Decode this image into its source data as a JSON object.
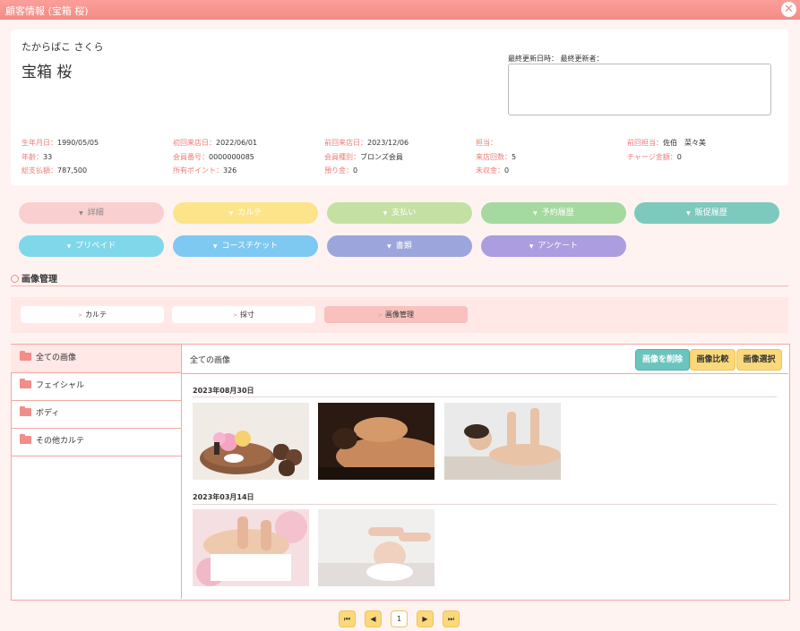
{
  "window": {
    "title": "顧客情報 (宝箱 桜)",
    "close_icon": "close-icon"
  },
  "customer": {
    "kana": "たからばこ さくら",
    "name": "宝箱 桜",
    "update_label": "最終更新日時： 最終更新者：",
    "memo": ""
  },
  "info": [
    {
      "label": "生年月日：",
      "value": "1990/05/05"
    },
    {
      "label": "初回来店日：",
      "value": "2022/06/01"
    },
    {
      "label": "前回来店日：",
      "value": "2023/12/06"
    },
    {
      "label": "担当：",
      "value": ""
    },
    {
      "label": "前回担当：",
      "value": "佐伯　菜々美"
    },
    {
      "label": "年齢：",
      "value": "33"
    },
    {
      "label": "会員番号：",
      "value": "0000000085"
    },
    {
      "label": "会員種別：",
      "value": "ブロンズ会員"
    },
    {
      "label": "来店回数：",
      "value": "5"
    },
    {
      "label": "チャージ金額：",
      "value": "0"
    },
    {
      "label": "総支払額：",
      "value": "787,500"
    },
    {
      "label": "所有ポイント：",
      "value": "326"
    },
    {
      "label": "預り金：",
      "value": "0"
    },
    {
      "label": "未収金：",
      "value": "0"
    }
  ],
  "section_buttons": [
    {
      "label": "詳細",
      "color": "#f9d0cf",
      "text": "#888"
    },
    {
      "label": "カルテ",
      "color": "#fde38a",
      "text": "#fff"
    },
    {
      "label": "支払い",
      "color": "#c5e0a3",
      "text": "#fff"
    },
    {
      "label": "予約履歴",
      "color": "#a4d99f",
      "text": "#fff"
    },
    {
      "label": "販促履歴",
      "color": "#7ec9be",
      "text": "#fff"
    },
    {
      "label": "プリペイド",
      "color": "#7fd7ea",
      "text": "#fff"
    },
    {
      "label": "コースチケット",
      "color": "#7ec9f1",
      "text": "#fff"
    },
    {
      "label": "書類",
      "color": "#9ca6dc",
      "text": "#fff"
    },
    {
      "label": "アンケート",
      "color": "#ab9ddf",
      "text": "#fff"
    }
  ],
  "section_title": "画像管理",
  "tabs": [
    {
      "label": "カルテ"
    },
    {
      "label": "採寸"
    },
    {
      "label": "画像管理"
    }
  ],
  "folders": [
    {
      "label": "全ての画像"
    },
    {
      "label": "フェイシャル"
    },
    {
      "label": "ボディ"
    },
    {
      "label": "その他カルテ"
    }
  ],
  "panel": {
    "title": "全ての画像",
    "delete_label": "画像を削除",
    "compare_label": "画像比較",
    "select_label": "画像選択"
  },
  "groups": [
    {
      "date": "2023年08月30日",
      "images": [
        "spa-aroma-photo",
        "back-massage-photo",
        "shoulder-massage-photo"
      ]
    },
    {
      "date": "2023年03月14日",
      "images": [
        "body-treatment-photo",
        "facial-massage-photo"
      ]
    }
  ],
  "pagination": {
    "first": "⏮",
    "prev": "◀",
    "current": "1",
    "next": "▶",
    "last": "⏭"
  }
}
